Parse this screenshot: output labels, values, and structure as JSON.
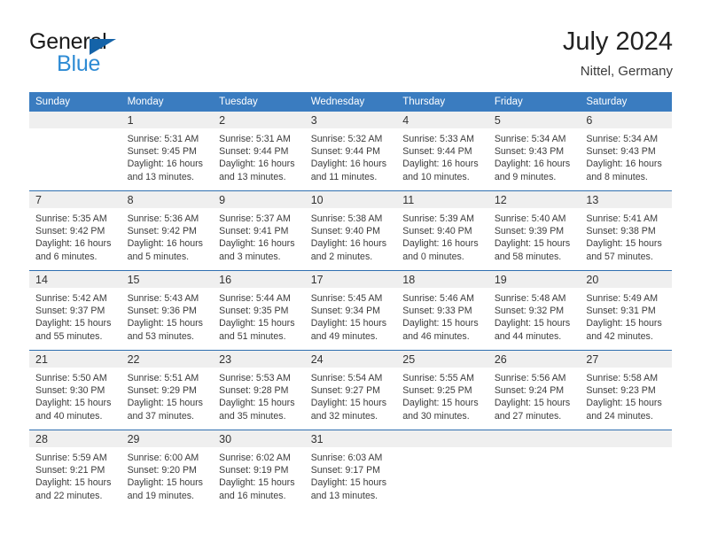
{
  "brand": {
    "line1": "General",
    "line2": "Blue",
    "mark": "triangle-logo"
  },
  "header": {
    "title": "July 2024",
    "location": "Nittel, Germany"
  },
  "calendar": {
    "weekday_headers": [
      "Sunday",
      "Monday",
      "Tuesday",
      "Wednesday",
      "Thursday",
      "Friday",
      "Saturday"
    ],
    "colors": {
      "header_background": "#3a7cc0",
      "row_separator": "#2f6fb0",
      "daynum_band": "#efefef",
      "brand_blue": "#2e8bd4",
      "brand_mark": "#1563a8"
    },
    "weeks": [
      [
        {
          "day": "",
          "lines": []
        },
        {
          "day": "1",
          "lines": [
            "Sunrise: 5:31 AM",
            "Sunset: 9:45 PM",
            "Daylight: 16 hours",
            "and 13 minutes."
          ]
        },
        {
          "day": "2",
          "lines": [
            "Sunrise: 5:31 AM",
            "Sunset: 9:44 PM",
            "Daylight: 16 hours",
            "and 13 minutes."
          ]
        },
        {
          "day": "3",
          "lines": [
            "Sunrise: 5:32 AM",
            "Sunset: 9:44 PM",
            "Daylight: 16 hours",
            "and 11 minutes."
          ]
        },
        {
          "day": "4",
          "lines": [
            "Sunrise: 5:33 AM",
            "Sunset: 9:44 PM",
            "Daylight: 16 hours",
            "and 10 minutes."
          ]
        },
        {
          "day": "5",
          "lines": [
            "Sunrise: 5:34 AM",
            "Sunset: 9:43 PM",
            "Daylight: 16 hours",
            "and 9 minutes."
          ]
        },
        {
          "day": "6",
          "lines": [
            "Sunrise: 5:34 AM",
            "Sunset: 9:43 PM",
            "Daylight: 16 hours",
            "and 8 minutes."
          ]
        }
      ],
      [
        {
          "day": "7",
          "lines": [
            "Sunrise: 5:35 AM",
            "Sunset: 9:42 PM",
            "Daylight: 16 hours",
            "and 6 minutes."
          ]
        },
        {
          "day": "8",
          "lines": [
            "Sunrise: 5:36 AM",
            "Sunset: 9:42 PM",
            "Daylight: 16 hours",
            "and 5 minutes."
          ]
        },
        {
          "day": "9",
          "lines": [
            "Sunrise: 5:37 AM",
            "Sunset: 9:41 PM",
            "Daylight: 16 hours",
            "and 3 minutes."
          ]
        },
        {
          "day": "10",
          "lines": [
            "Sunrise: 5:38 AM",
            "Sunset: 9:40 PM",
            "Daylight: 16 hours",
            "and 2 minutes."
          ]
        },
        {
          "day": "11",
          "lines": [
            "Sunrise: 5:39 AM",
            "Sunset: 9:40 PM",
            "Daylight: 16 hours",
            "and 0 minutes."
          ]
        },
        {
          "day": "12",
          "lines": [
            "Sunrise: 5:40 AM",
            "Sunset: 9:39 PM",
            "Daylight: 15 hours",
            "and 58 minutes."
          ]
        },
        {
          "day": "13",
          "lines": [
            "Sunrise: 5:41 AM",
            "Sunset: 9:38 PM",
            "Daylight: 15 hours",
            "and 57 minutes."
          ]
        }
      ],
      [
        {
          "day": "14",
          "lines": [
            "Sunrise: 5:42 AM",
            "Sunset: 9:37 PM",
            "Daylight: 15 hours",
            "and 55 minutes."
          ]
        },
        {
          "day": "15",
          "lines": [
            "Sunrise: 5:43 AM",
            "Sunset: 9:36 PM",
            "Daylight: 15 hours",
            "and 53 minutes."
          ]
        },
        {
          "day": "16",
          "lines": [
            "Sunrise: 5:44 AM",
            "Sunset: 9:35 PM",
            "Daylight: 15 hours",
            "and 51 minutes."
          ]
        },
        {
          "day": "17",
          "lines": [
            "Sunrise: 5:45 AM",
            "Sunset: 9:34 PM",
            "Daylight: 15 hours",
            "and 49 minutes."
          ]
        },
        {
          "day": "18",
          "lines": [
            "Sunrise: 5:46 AM",
            "Sunset: 9:33 PM",
            "Daylight: 15 hours",
            "and 46 minutes."
          ]
        },
        {
          "day": "19",
          "lines": [
            "Sunrise: 5:48 AM",
            "Sunset: 9:32 PM",
            "Daylight: 15 hours",
            "and 44 minutes."
          ]
        },
        {
          "day": "20",
          "lines": [
            "Sunrise: 5:49 AM",
            "Sunset: 9:31 PM",
            "Daylight: 15 hours",
            "and 42 minutes."
          ]
        }
      ],
      [
        {
          "day": "21",
          "lines": [
            "Sunrise: 5:50 AM",
            "Sunset: 9:30 PM",
            "Daylight: 15 hours",
            "and 40 minutes."
          ]
        },
        {
          "day": "22",
          "lines": [
            "Sunrise: 5:51 AM",
            "Sunset: 9:29 PM",
            "Daylight: 15 hours",
            "and 37 minutes."
          ]
        },
        {
          "day": "23",
          "lines": [
            "Sunrise: 5:53 AM",
            "Sunset: 9:28 PM",
            "Daylight: 15 hours",
            "and 35 minutes."
          ]
        },
        {
          "day": "24",
          "lines": [
            "Sunrise: 5:54 AM",
            "Sunset: 9:27 PM",
            "Daylight: 15 hours",
            "and 32 minutes."
          ]
        },
        {
          "day": "25",
          "lines": [
            "Sunrise: 5:55 AM",
            "Sunset: 9:25 PM",
            "Daylight: 15 hours",
            "and 30 minutes."
          ]
        },
        {
          "day": "26",
          "lines": [
            "Sunrise: 5:56 AM",
            "Sunset: 9:24 PM",
            "Daylight: 15 hours",
            "and 27 minutes."
          ]
        },
        {
          "day": "27",
          "lines": [
            "Sunrise: 5:58 AM",
            "Sunset: 9:23 PM",
            "Daylight: 15 hours",
            "and 24 minutes."
          ]
        }
      ],
      [
        {
          "day": "28",
          "lines": [
            "Sunrise: 5:59 AM",
            "Sunset: 9:21 PM",
            "Daylight: 15 hours",
            "and 22 minutes."
          ]
        },
        {
          "day": "29",
          "lines": [
            "Sunrise: 6:00 AM",
            "Sunset: 9:20 PM",
            "Daylight: 15 hours",
            "and 19 minutes."
          ]
        },
        {
          "day": "30",
          "lines": [
            "Sunrise: 6:02 AM",
            "Sunset: 9:19 PM",
            "Daylight: 15 hours",
            "and 16 minutes."
          ]
        },
        {
          "day": "31",
          "lines": [
            "Sunrise: 6:03 AM",
            "Sunset: 9:17 PM",
            "Daylight: 15 hours",
            "and 13 minutes."
          ]
        },
        {
          "day": "",
          "lines": []
        },
        {
          "day": "",
          "lines": []
        },
        {
          "day": "",
          "lines": []
        }
      ]
    ]
  }
}
